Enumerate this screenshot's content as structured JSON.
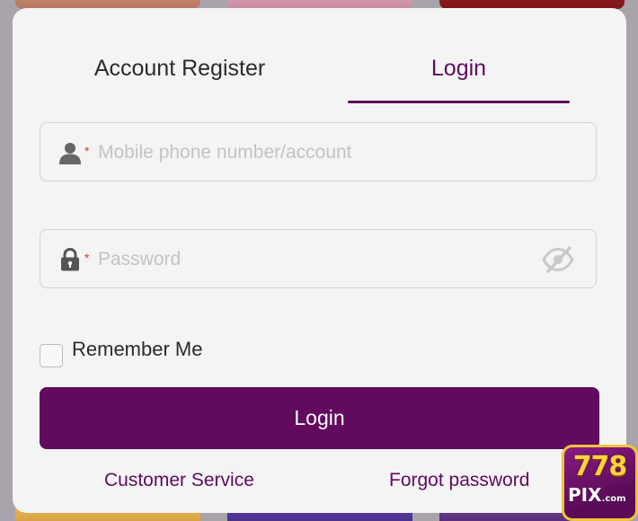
{
  "tabs": {
    "register_label": "Account Register",
    "login_label": "Login",
    "active": "Login"
  },
  "form": {
    "account": {
      "value": "",
      "placeholder": "Mobile phone number/account",
      "icon": "user-icon",
      "required_mark": "*"
    },
    "password": {
      "value": "",
      "placeholder": "Password",
      "icon": "lock-icon",
      "required_mark": "*",
      "toggle_icon": "eye-slash-icon"
    },
    "remember": {
      "label": "Remember Me",
      "checked": false
    },
    "submit_label": "Login"
  },
  "links": {
    "customer_service": "Customer Service",
    "forgot_password": "Forgot password"
  },
  "logo": {
    "number": "778",
    "brand": "PIX",
    "suffix": ".com"
  },
  "colors": {
    "accent": "#620a5e",
    "required": "#d23b2e",
    "background": "#f4f4f4"
  }
}
